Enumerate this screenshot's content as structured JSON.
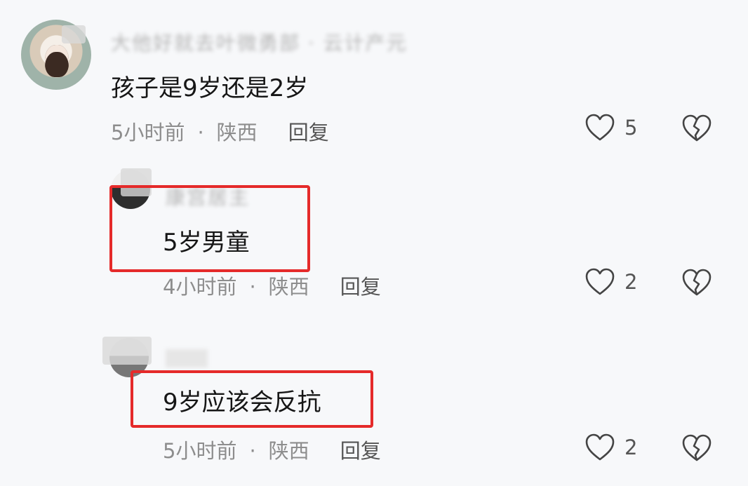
{
  "comments": [
    {
      "username": "大他好就去叶微勇部 · 云计产元",
      "text": "孩子是9岁还是2岁",
      "time": "5小时前",
      "location": "陕西",
      "reply_label": "回复",
      "likes": "5"
    },
    {
      "username": "康宫居主",
      "text": "5岁男童",
      "time": "4小时前",
      "location": "陕西",
      "reply_label": "回复",
      "likes": "2"
    },
    {
      "username": "",
      "text": "9岁应该会反抗",
      "time": "5小时前",
      "location": "陕西",
      "reply_label": "回复",
      "likes": "2"
    }
  ],
  "colors": {
    "highlight_border": "#e52a2a"
  },
  "icons": {
    "like": "heart-outline-icon",
    "dislike": "broken-heart-icon"
  }
}
